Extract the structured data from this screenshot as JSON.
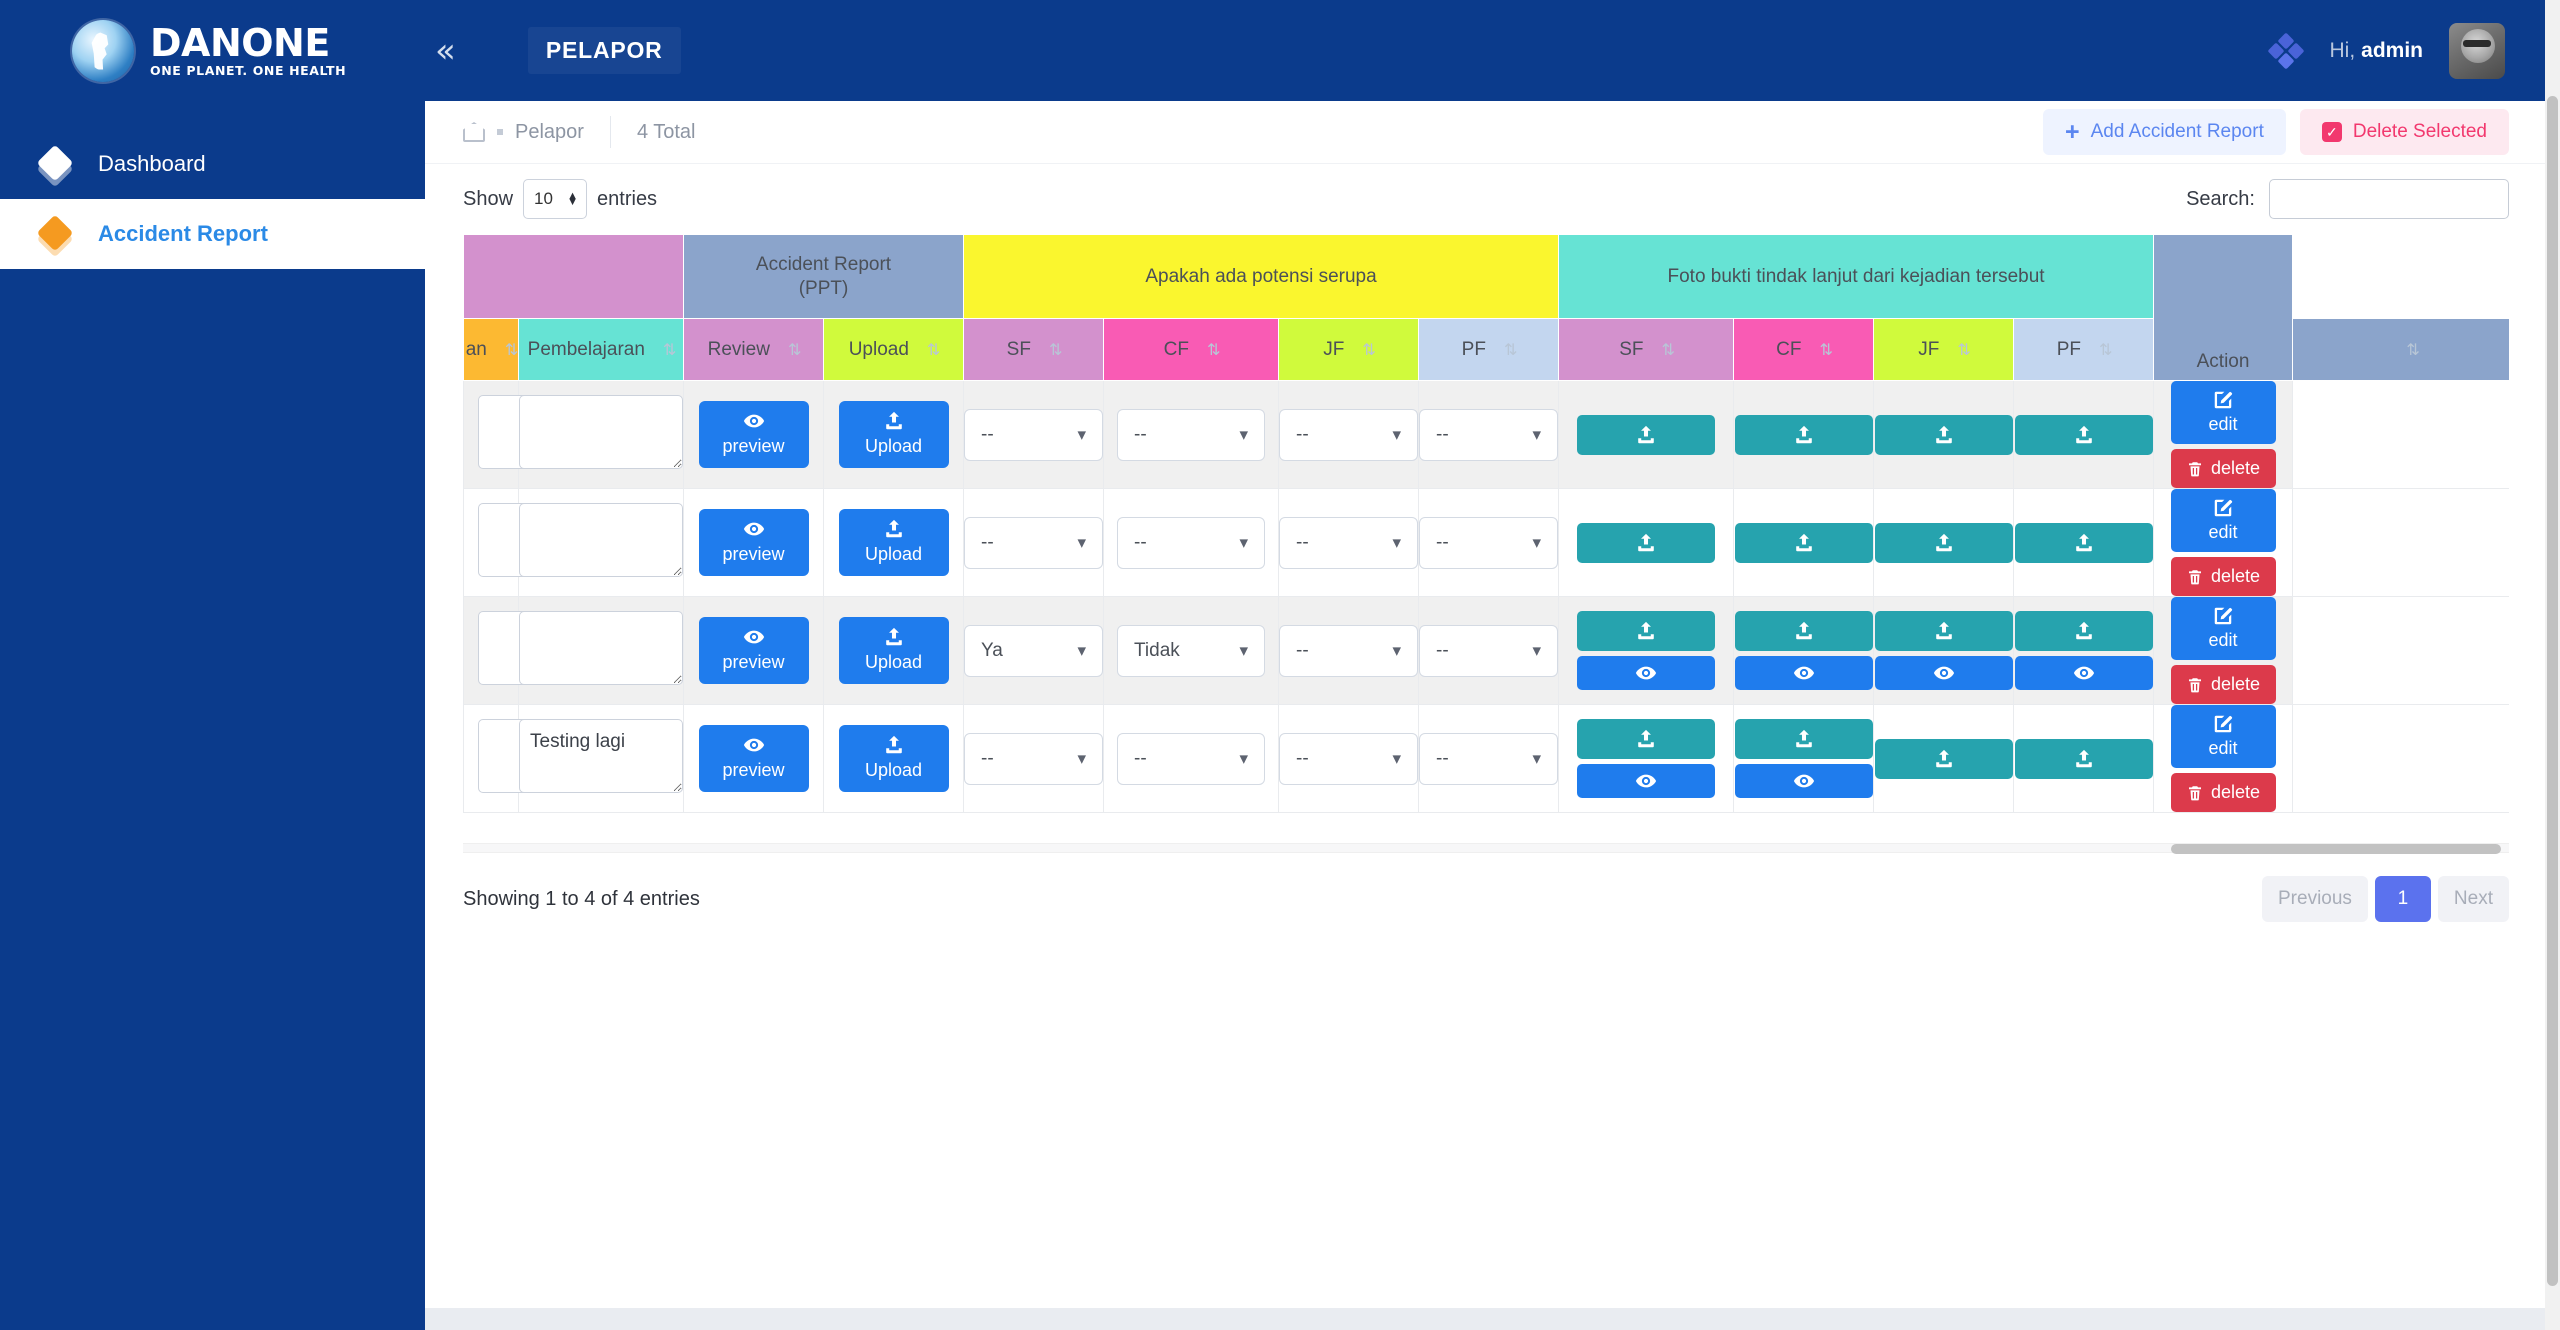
{
  "brand": {
    "name": "DANONE",
    "tagline": "ONE PLANET. ONE HEALTH",
    "collapse_icon": "chevrons-left-icon"
  },
  "header": {
    "page_tab": "PELAPOR",
    "greeting": "Hi,",
    "username": "admin",
    "apps_icon": "diamond-cluster-icon",
    "avatar_icon": "user-avatar"
  },
  "sidebar": {
    "items": [
      {
        "label": "Dashboard",
        "icon": "layers-icon",
        "active": false
      },
      {
        "label": "Accident Report",
        "icon": "layers-icon",
        "active": true
      }
    ]
  },
  "breadcrumb": {
    "home_icon": "home-icon",
    "current": "Pelapor",
    "total": "4 Total",
    "add_button": "Add Accident Report",
    "add_icon": "plus-icon",
    "delete_button": "Delete Selected",
    "delete_icon": "checkbox-checked-icon"
  },
  "table_controls": {
    "show_label": "Show",
    "entries_label": "entries",
    "page_length": "10",
    "search_label": "Search:",
    "search_value": "",
    "search_placeholder": ""
  },
  "table": {
    "group_headers": [
      {
        "label": "",
        "color": "#d391cd",
        "span": 2
      },
      {
        "label": "Accident Report (PPT)",
        "color": "#8ba4cb",
        "span": 2
      },
      {
        "label": "Apakah ada potensi serupa",
        "color": "#faf62e",
        "span": 4
      },
      {
        "label": "Foto bukti tindak lanjut dari kejadian tersebut",
        "color": "#66e3d4",
        "span": 4
      },
      {
        "label": "Action",
        "color": "#8ba4cb",
        "span": 1
      }
    ],
    "columns": [
      {
        "label": "an",
        "color": "#fcb932",
        "sort_icon": "sort-icon"
      },
      {
        "label": "Pembelajaran",
        "color": "#66e3d4",
        "sort_icon": "sort-icon"
      },
      {
        "label": "Review",
        "color": "#d391cd",
        "sort_icon": "sort-icon"
      },
      {
        "label": "Upload",
        "color": "#d0fa3c",
        "sort_icon": "sort-icon"
      },
      {
        "label": "SF",
        "color": "#d391cd",
        "sort_icon": "sort-icon"
      },
      {
        "label": "CF",
        "color": "#f95bb4",
        "sort_icon": "sort-icon"
      },
      {
        "label": "JF",
        "color": "#d0fa3c",
        "sort_icon": "sort-icon"
      },
      {
        "label": "PF",
        "color": "#c3d6ef",
        "sort_icon": "sort-icon"
      },
      {
        "label": "SF",
        "color": "#d391cd",
        "sort_icon": "sort-icon"
      },
      {
        "label": "CF",
        "color": "#f95bb4",
        "sort_icon": "sort-icon"
      },
      {
        "label": "JF",
        "color": "#d0fa3c",
        "sort_icon": "sort-icon"
      },
      {
        "label": "PF",
        "color": "#c3d6ef",
        "sort_icon": "sort-icon"
      },
      {
        "label": "",
        "color": "#8ba4cb",
        "sort_icon": "sort-icon"
      }
    ],
    "buttons": {
      "preview_label": "preview",
      "preview_icon": "eye-icon",
      "upload_label": "Upload",
      "upload_icon": "upload-icon",
      "edit_label": "edit",
      "edit_icon": "pen-square-icon",
      "delete_label": "delete",
      "delete_icon": "trash-icon"
    },
    "rows": [
      {
        "partial_text": "",
        "pembelajaran": "",
        "potensi": [
          "--",
          "--",
          "--",
          "--"
        ],
        "foto_has_preview": [
          false,
          false,
          false,
          false
        ]
      },
      {
        "partial_text": "",
        "pembelajaran": "",
        "potensi": [
          "--",
          "--",
          "--",
          "--"
        ],
        "foto_has_preview": [
          false,
          false,
          false,
          false
        ]
      },
      {
        "partial_text": "",
        "pembelajaran": "",
        "potensi": [
          "Ya",
          "Tidak",
          "--",
          "--"
        ],
        "foto_has_preview": [
          true,
          true,
          true,
          true
        ]
      },
      {
        "partial_text": "",
        "pembelajaran": "Testing lagi",
        "potensi": [
          "--",
          "--",
          "--",
          "--"
        ],
        "foto_has_preview": [
          true,
          true,
          false,
          false
        ]
      }
    ]
  },
  "footer": {
    "info": "Showing 1 to 4 of 4 entries",
    "previous": "Previous",
    "current_page": "1",
    "next": "Next"
  }
}
